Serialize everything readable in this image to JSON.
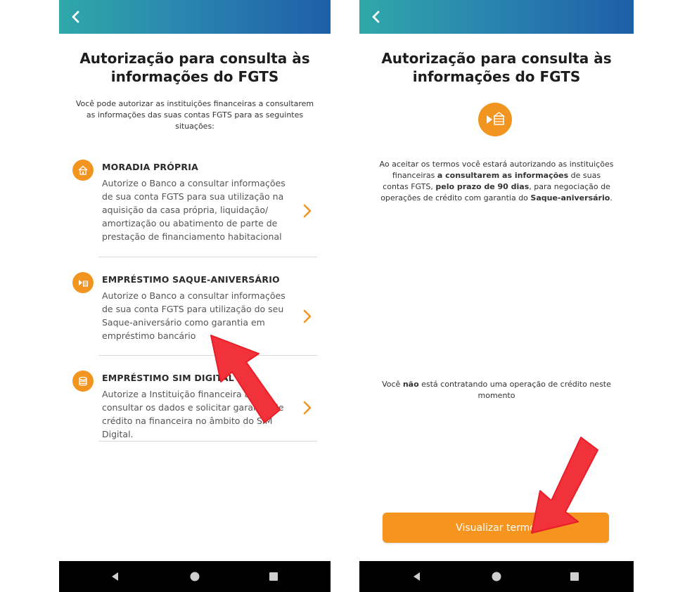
{
  "left_screen": {
    "title_line1": "Autorização para consulta às",
    "title_line2": "informações do FGTS",
    "intro": "Você pode autorizar as instituições financeiras a consultarem as informações das suas contas FGTS para as seguintes situações:",
    "options": [
      {
        "title": "MORADIA PRÓPRIA",
        "description": "Autorize o Banco a consultar informações de sua conta FGTS para sua utilização na aquisição da casa própria, liquidação/ amortização ou abatimento de parte de prestação de financiamento habitacional",
        "icon": "house-icon"
      },
      {
        "title": "EMPRÉSTIMO SAQUE-ANIVERSÁRIO",
        "description": "Autorize o Banco a consultar informações de sua conta FGTS para utilização do seu Saque-aniversário como garantia em empréstimo bancário",
        "icon": "play-building-icon"
      },
      {
        "title": "EMPRÉSTIMO SIM DIGITAL",
        "description": "Autorize a Instituição financeira a consultar os dados e solicitar garantia de crédito na financeira no âmbito do SIM Digital.",
        "icon": "coins-icon"
      }
    ]
  },
  "right_screen": {
    "title_line1": "Autorização para consulta às",
    "title_line2": "informações do FGTS",
    "terms": {
      "p1": "Ao aceitar os termos você estará autorizando as instituições financeiras ",
      "b1": "a consultarem as informações",
      "p2": " de suas contas FGTS, ",
      "b2": "pelo prazo de 90 dias",
      "p3": ", para negociação de operações de crédito com garantia do ",
      "b3": "Saque-aniversário",
      "p4": "."
    },
    "notice": {
      "p1": "Você ",
      "b1": "não",
      "p2": " está contratando uma operação de crédito neste momento"
    },
    "button_label": "Visualizar termo"
  },
  "colors": {
    "accent": "#f5951f",
    "header_gradient_start": "#2fa8a8",
    "header_gradient_end": "#1f5ea8",
    "annotation_arrow": "#f2323a"
  },
  "icons": {
    "back": "chevron-left-icon",
    "nav": [
      "back-triangle-icon",
      "home-circle-icon",
      "recents-square-icon"
    ]
  }
}
